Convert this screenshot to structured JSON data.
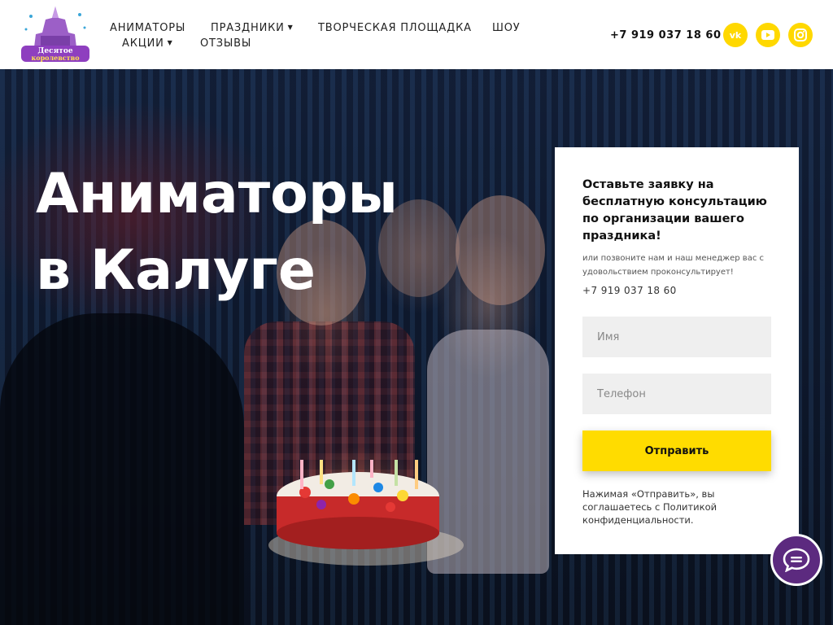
{
  "header": {
    "logo_text": "Десятое королевство",
    "nav": [
      {
        "label": "АНИМАТОРЫ",
        "has_dropdown": false
      },
      {
        "label": "ПРАЗДНИКИ",
        "has_dropdown": true
      },
      {
        "label": "ТВОРЧЕСКАЯ ПЛОЩАДКА",
        "has_dropdown": false
      },
      {
        "label": "ШОУ",
        "has_dropdown": false
      },
      {
        "label": "АКЦИИ",
        "has_dropdown": true
      },
      {
        "label": "ОТЗЫВЫ",
        "has_dropdown": false
      }
    ],
    "phone": "+7 919 037 18 60",
    "social": [
      {
        "name": "vk-icon",
        "glyph": "vk"
      },
      {
        "name": "youtube-icon",
        "glyph": "▶"
      },
      {
        "name": "instagram-icon",
        "glyph": "ig"
      }
    ],
    "accent_color": "#ffd800"
  },
  "hero": {
    "title_line1": "Аниматоры",
    "title_line2": "в Калуге"
  },
  "form": {
    "heading": "Оставьте заявку на бесплатную консультацию по организации вашего праздника!",
    "subtext": "или позвоните нам и наш менеджер вас с удовольствием проконсультирует!",
    "phone": "+7 919 037 18 60",
    "name_placeholder": "Имя",
    "phone_placeholder": "Телефон",
    "submit_label": "Отправить",
    "policy_text": "Нажимая «Отправить», вы соглашаетесь с Политикой конфиденциальности.",
    "button_color": "#ffdc00"
  },
  "chat": {
    "color": "#5c2a7f"
  }
}
